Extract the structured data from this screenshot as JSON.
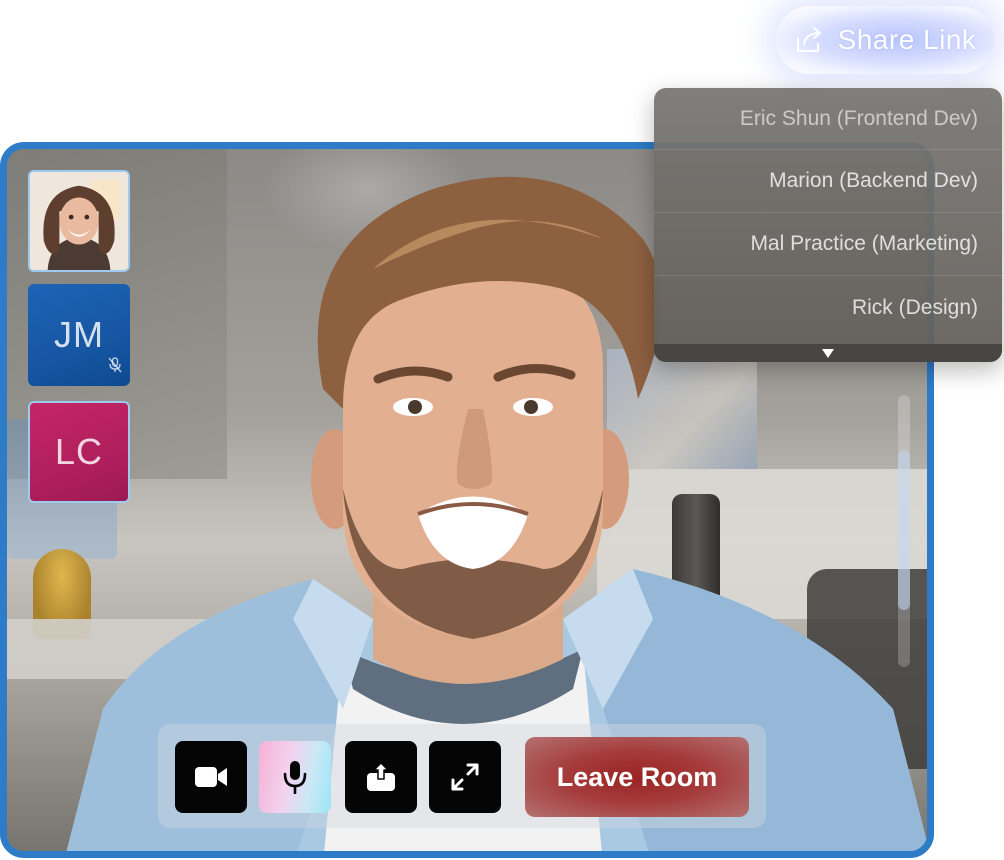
{
  "header": {
    "share_link_label": "Share Link",
    "share_icon": "share-external-icon"
  },
  "participants_menu": {
    "items": [
      {
        "label": "Eric Shun (Frontend Dev)"
      },
      {
        "label": "Marion  (Backend Dev)"
      },
      {
        "label": "Mal Practice (Marketing)"
      },
      {
        "label": "Rick (Design)"
      }
    ],
    "expand_icon": "triangle-down-icon"
  },
  "thumbnails": {
    "first": {
      "kind": "photo"
    },
    "second": {
      "initials": "JM",
      "muted": true,
      "color": "#1f63b6"
    },
    "third": {
      "initials": "LC",
      "muted": false,
      "color": "#c42667"
    }
  },
  "controls": {
    "camera_icon": "video-camera-icon",
    "mic_icon": "microphone-icon",
    "share_icon": "share-screen-icon",
    "expand_icon": "fullscreen-icon",
    "leave_label": "Leave Room"
  },
  "colors": {
    "frame_border": "#2e7bc7",
    "leave_button": "#9b2323",
    "share_glow": "#b9c6ff"
  }
}
